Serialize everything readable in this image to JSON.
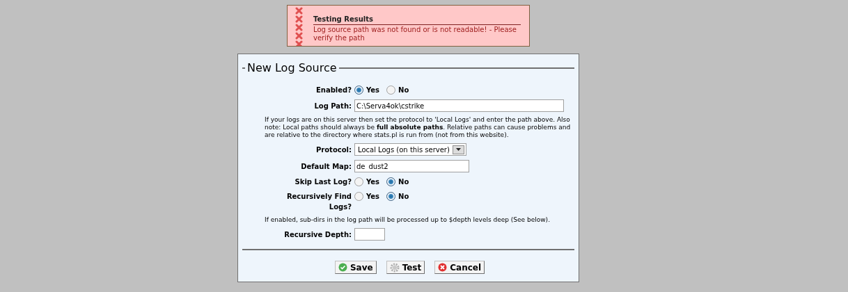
{
  "alert": {
    "title": "Testing Results",
    "message": "Log source path was not found or is not readable! - Please verify the path"
  },
  "form": {
    "title": "New Log Source",
    "fields": [
      {
        "kind": "radio",
        "label": "Enabled?",
        "options": [
          {
            "label": "Yes",
            "selected": true
          },
          {
            "label": "No",
            "selected": false
          }
        ]
      },
      {
        "kind": "path",
        "label": "Log Path:",
        "value": "C:\\Serva4ok\\cstrike"
      },
      {
        "kind": "note",
        "text": "If your logs are on this server then set the protocol to 'Local Logs' and enter the path above. Also note: Local paths should always be **full absolute paths**. Relative paths can cause problems and are relative to the directory where stats.pl is run from (not from this website)."
      },
      {
        "kind": "select",
        "label": "Protocol:",
        "value": "Local Logs (on this server)"
      },
      {
        "kind": "text",
        "label": "Default Map:",
        "value": "de_dust2"
      },
      {
        "kind": "radio",
        "label": "Skip Last Log?",
        "options": [
          {
            "label": "Yes",
            "selected": false
          },
          {
            "label": "No",
            "selected": true
          }
        ]
      },
      {
        "kind": "radio",
        "label": "Recursively Find Logs?",
        "options": [
          {
            "label": "Yes",
            "selected": false
          },
          {
            "label": "No",
            "selected": true
          }
        ]
      },
      {
        "kind": "note",
        "text": "If enabled, sub-dirs in the log path will be processed up to $depth levels deep (See below)."
      },
      {
        "kind": "number",
        "label": "Recursive Depth:"
      }
    ]
  },
  "buttons": [
    {
      "kind": "save",
      "label": "Save"
    },
    {
      "kind": "test",
      "label": "Test"
    },
    {
      "kind": "cancel",
      "label": "Cancel"
    }
  ]
}
